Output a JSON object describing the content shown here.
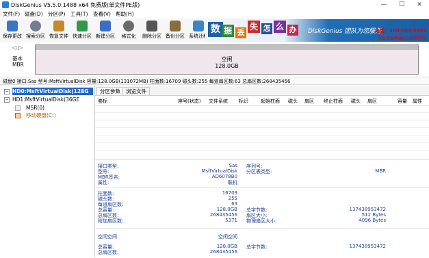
{
  "window": {
    "title": "DiskGenius V5.5.0.1488 x64 免费版(单文件PE版)",
    "minimize": "—",
    "maximize": "☐",
    "close": "✕"
  },
  "menu": [
    "文件(F)",
    "磁盘(D)",
    "分区(P)",
    "工具(T)",
    "查看(V)",
    "帮助(H)"
  ],
  "toolbar": [
    {
      "label": "保存更改",
      "icon": "save-icon",
      "color": "#3a75c4"
    },
    {
      "label": "搜索分区",
      "icon": "search-icon",
      "color": "#6f7f91"
    },
    {
      "label": "恢复文件",
      "icon": "recover-file-icon",
      "color": "#c58a27"
    },
    {
      "label": "快速分区",
      "icon": "quick-partition-icon",
      "color": "#2f9a4b"
    },
    {
      "label": "新建分区",
      "icon": "new-partition-icon",
      "color": "#3c6ec8"
    },
    {
      "label": "格式化",
      "icon": "format-icon",
      "color": "#6a6a6a"
    },
    {
      "label": "删除分区",
      "icon": "delete-partition-icon",
      "color": "#555555"
    },
    {
      "label": "备份分区",
      "icon": "backup-partition-icon",
      "color": "#8a6d3b"
    },
    {
      "label": "系统迁移",
      "icon": "system-migration-icon",
      "color": "#3a86c8"
    }
  ],
  "banner": {
    "chars": [
      "数",
      "据",
      "丢",
      "失",
      "怎",
      "么",
      "办"
    ],
    "slogan": "DiskGenius 团队为您服务",
    "phone": "电话：400-008-9958",
    "qq": "点此添加客服QQ获得帮助"
  },
  "diskmap": {
    "nav_left": "◁",
    "nav_right": "▷",
    "basic": "基本",
    "mbr": "MBR",
    "partition_name": "空闲",
    "partition_size": "128.0GB"
  },
  "diskinfo": "磁盘0 接口:Sas  型号:MsftVirtualDisk  容量:128.0GB(131072MB)  柱面数:16709  磁头数:255  每道扇区数:63  总扇区数:268435456",
  "tree": {
    "hd0": "HD0:MsftVirtualDisk(128G",
    "hd1": "HD1:MsftVirtualDisk(36GE",
    "msr": "MSR(0)",
    "c": "移动硬盘(C:)"
  },
  "tabs": [
    "分区参数",
    "浏览文件"
  ],
  "columns": [
    "卷标",
    "序号(状态)",
    "文件系统",
    "标识",
    "起始柱面",
    "磁头",
    "扇区",
    "终止柱面",
    "磁头",
    "扇区",
    "容量",
    "属性"
  ],
  "details": {
    "left": [
      {
        "label": "接口类型:",
        "value": "Sas"
      },
      {
        "label": "型号:",
        "value": "MsftVirtualDisk"
      },
      {
        "label": "MBR签名:",
        "value": "AD6078B0"
      },
      {
        "label": "属性:",
        "value": "联机"
      }
    ],
    "right": [
      {
        "label": "序列号:",
        "value": ""
      },
      {
        "label": "分区表类型:",
        "value": "MBR"
      }
    ],
    "geo_left": [
      {
        "label": "柱面数:",
        "value": "16709"
      },
      {
        "label": "磁头数:",
        "value": "255"
      },
      {
        "label": "每道扇区数:",
        "value": "63"
      },
      {
        "label": "总容量:",
        "value": "128.0GB"
      },
      {
        "label": "总扇区数:",
        "value": "268435456"
      },
      {
        "label": "附加扇区数:",
        "value": "5371"
      }
    ],
    "geo_right": [
      {
        "label": "总字节数:",
        "value": "137438953472"
      },
      {
        "label": "扇区大小:",
        "value": "512 Bytes"
      },
      {
        "label": "物理扇区大小:",
        "value": "4096 Bytes"
      }
    ],
    "free_left": [
      {
        "label": "空闲空间",
        "value": "空闲空间"
      },
      {
        "label": "总容量:",
        "value": "128.0GB"
      },
      {
        "label": "总扇区数:",
        "value": "268435456"
      }
    ],
    "free_right": [
      {
        "label": "总字节数:",
        "value": "137438953472"
      }
    ]
  }
}
